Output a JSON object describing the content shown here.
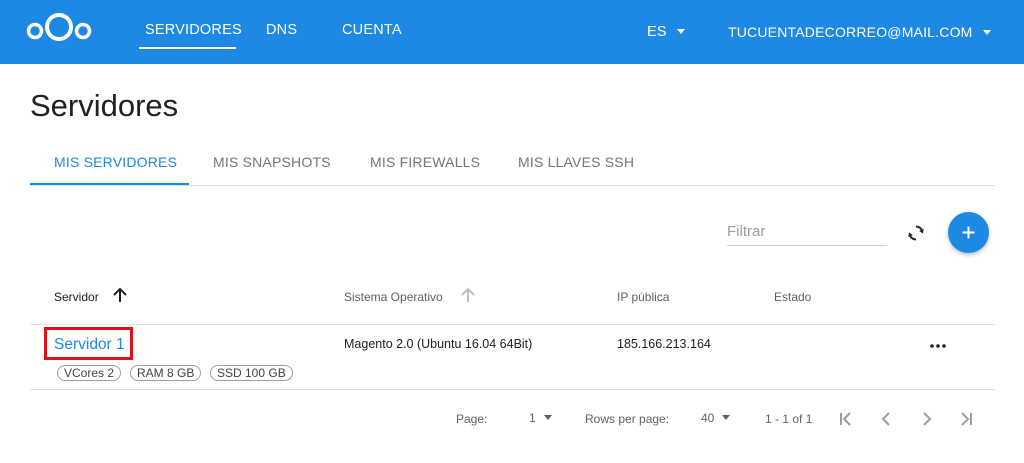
{
  "header": {
    "nav": [
      "SERVIDORES",
      "DNS",
      "CUENTA"
    ],
    "language": "ES",
    "account": "TUCUENTADECORREO@MAIL.COM"
  },
  "page": {
    "title": "Servidores",
    "tabs": [
      "MIS SERVIDORES",
      "MIS SNAPSHOTS",
      "MIS FIREWALLS",
      "MIS LLAVES SSH"
    ]
  },
  "toolbar": {
    "filter_placeholder": "Filtrar"
  },
  "table": {
    "columns": [
      "Servidor",
      "Sistema Operativo",
      "IP pública",
      "Estado"
    ],
    "rows": [
      {
        "name": "Servidor 1",
        "specs": [
          "VCores 2",
          "RAM 8 GB",
          "SSD 100 GB"
        ],
        "os": "Magento 2.0 (Ubuntu 16.04 64Bit)",
        "ip": "185.166.213.164",
        "status": ""
      }
    ]
  },
  "pagination": {
    "page_label": "Page:",
    "page": "1",
    "rows_label": "Rows per page:",
    "rows_per_page": "40",
    "range": "1 - 1 of 1"
  },
  "colors": {
    "primary": "#1e88e5",
    "highlight": "#e0101b"
  }
}
